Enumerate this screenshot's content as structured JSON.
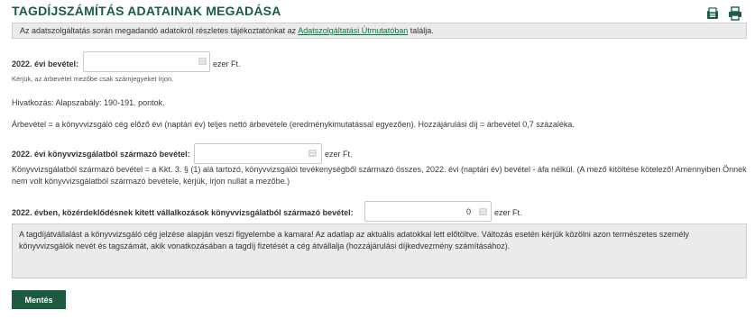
{
  "page": {
    "title": "TAGDÍJSZÁMÍTÁS ADATAINAK MEGADÁSA",
    "info_before_link": "Az adatszolgáltatás során megadandó adatokról részletes tájékoztatónkat az ",
    "info_link": "Adatszolgáltatási Útmutatóban",
    "info_after_link": " találja."
  },
  "icons": {
    "export": "export-icon",
    "print": "print-icon"
  },
  "colors": {
    "brand_green": "#1b5e3f",
    "button_green": "#1d5b3f",
    "box_gray": "#ebebeb"
  },
  "form": {
    "revenue": {
      "label": "2022. évi bevétel:",
      "value": "",
      "unit": "ezer Ft.",
      "note": "Kérjük, az árbevétel mezőbe csak számjegyeket írjon."
    },
    "reference": "Hivatkozás: Alapszabály: 190-191. pontok.",
    "definition": "Árbevétel = a könyvvizsgáló cég előző évi (naptári év) teljes nettó árbevétele (eredménykimutatással egyezően). Hozzájárulási díj = árbevétel 0,7 százaléka.",
    "audit_revenue": {
      "label": "2022. évi könyvvizsgálatból származó bevétel:",
      "value": "",
      "unit": "ezer Ft.",
      "desc": "Könyvvizsgálatból származó bevétel = a Kkt. 3. § (1) alá tartozó, könyvvizsgálói tevékenységből származó összes, 2022. évi (naptári év) bevétel - áfa nélkül. (A mező kitöltése kötelező! Amennyiben Önnek nem volt könyvvizsgálatból származó bevétele, kérjük, írjon nullát a mezőbe.)"
    },
    "pie_revenue": {
      "label": "2022. évben, közérdeklődésnek kitett vállalkozások könyvvizsgálatból származó bevétel:",
      "value": "0",
      "unit": "ezer Ft."
    }
  },
  "notice": "A tagdíjátvállalást a könyvvizsgáló cég jelzése alapján veszi figyelembe a kamara! Az adatlap az aktuális adatokkal lett előtöltve. Változás esetén kérjük közölni azon természetes személy könyvvizsgálók nevét és tagszámát, akik vonatkozásában a tagdíj fizetését a cég átvállalja (hozzájárulási díjkedvezmény számításához).",
  "save_button": "Mentés"
}
